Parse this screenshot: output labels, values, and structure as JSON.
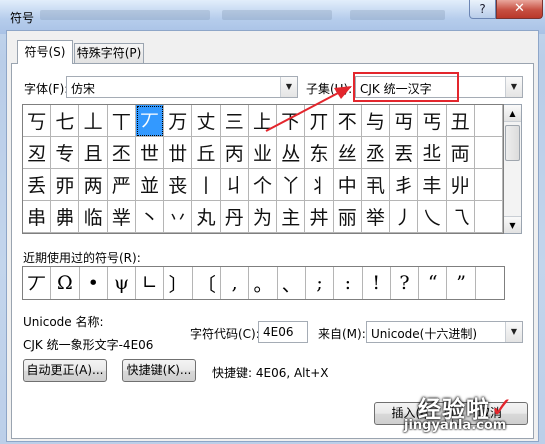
{
  "window": {
    "title": "符号",
    "help": "?",
    "close": "✕"
  },
  "tabs": [
    {
      "label": "符号(S)"
    },
    {
      "label": "特殊字符(P)"
    }
  ],
  "font": {
    "label": "字体(F):",
    "value": "仿宋"
  },
  "subset": {
    "label": "子集(U):",
    "value": "CJK 统一汉字"
  },
  "symbol_grid": [
    [
      "丂",
      "七",
      "丄",
      "丅",
      "丆",
      "万",
      "丈",
      "三",
      "上",
      "下",
      "丌",
      "不",
      "与",
      "丏",
      "丐",
      "丑"
    ],
    [
      "丒",
      "专",
      "且",
      "丕",
      "世",
      "丗",
      "丘",
      "丙",
      "业",
      "丛",
      "东",
      "丝",
      "丞",
      "丟",
      "丠",
      "両"
    ],
    [
      "丢",
      "丣",
      "两",
      "严",
      "並",
      "丧",
      "丨",
      "丩",
      "个",
      "丫",
      "丬",
      "中",
      "丮",
      "丯",
      "丰",
      "丱"
    ],
    [
      "串",
      "丳",
      "临",
      "丵",
      "丶",
      "丷",
      "丸",
      "丹",
      "为",
      "主",
      "丼",
      "丽",
      "举",
      "丿",
      "乀",
      "乁"
    ]
  ],
  "selected_symbol": "丆",
  "recent": {
    "label": "近期使用过的符号(R):",
    "symbols": [
      "丆",
      "Ω",
      "•",
      "ψ",
      "∟",
      "〕",
      "〔",
      ",",
      "。",
      "、",
      ";",
      ":",
      "!",
      "?",
      "“",
      "”"
    ]
  },
  "unicode_name": {
    "label": "Unicode 名称:",
    "value": "CJK 统一象形文字-4E06"
  },
  "char_code": {
    "label": "字符代码(C):",
    "value": "4E06"
  },
  "from": {
    "label": "来自(M):",
    "value": "Unicode(十六进制)"
  },
  "buttons": {
    "autocorrect": "自动更正(A)...",
    "shortcut_key": "快捷键(K)...",
    "insert": "插入(I)",
    "cancel": "取消"
  },
  "shortcut": "快捷键: 4E06, Alt+X",
  "watermark": {
    "text": "经验啦",
    "check": "✓",
    "url": "jingyanla.com"
  },
  "colors": {
    "accent_highlight": "#e3262d",
    "selection": "#3399ff"
  }
}
